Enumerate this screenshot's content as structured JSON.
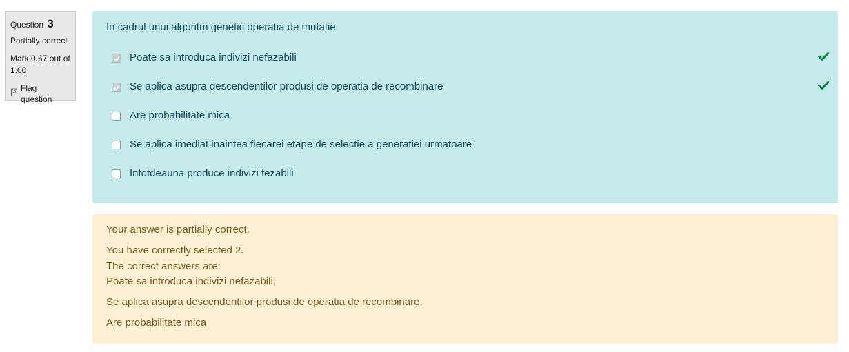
{
  "info": {
    "question_label": "Question",
    "question_number": "3",
    "state": "Partially correct",
    "grade": "Mark 0.67 out of 1.00",
    "flag_label": "Flag question"
  },
  "question": {
    "text": "In cadrul unui algoritm genetic operatia de mutatie",
    "answers": [
      {
        "label": "Poate sa introduca indivizi nefazabili",
        "checked": true,
        "correct_mark": true
      },
      {
        "label": "Se aplica asupra descendentilor produsi de operatia de recombinare",
        "checked": true,
        "correct_mark": true
      },
      {
        "label": "Are probabilitate mica",
        "checked": false,
        "correct_mark": false
      },
      {
        "label": "Se aplica imediat inaintea fiecarei etape de selectie a generatiei urmatoare",
        "checked": false,
        "correct_mark": false
      },
      {
        "label": "Intotdeauna produce indivizi fezabili",
        "checked": false,
        "correct_mark": false
      }
    ]
  },
  "feedback": {
    "summary": "Your answer is partially correct.",
    "selected_count": "You have correctly selected 2.",
    "correct_intro": "The correct answers are:",
    "correct_answer_1": "Poate sa introduca indivizi nefazabili,",
    "correct_answer_2": "Se aplica asupra descendentilor produsi de operatia de recombinare,",
    "correct_answer_3": "Are probabilitate mica"
  },
  "colors": {
    "formulation_bg": "#c5eaea",
    "feedback_bg": "#fdefd3",
    "correct_green": "#0f7c3c",
    "info_bg": "#e9e9e9"
  },
  "icons": {
    "flag": "flag-icon",
    "correct": "check-icon"
  }
}
